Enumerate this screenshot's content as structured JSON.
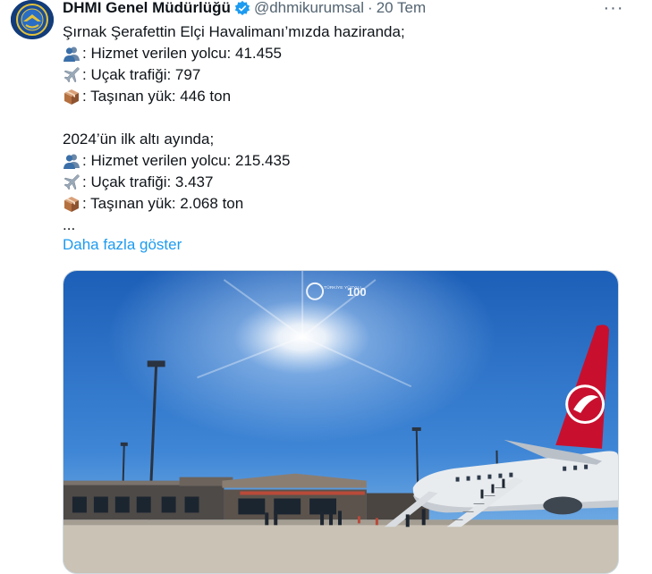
{
  "author": {
    "name": "DHMI Genel Müdürlüğü",
    "handle": "@dhmikurumsal",
    "separator": "·",
    "time": "20 Tem",
    "verified_icon": "verified-badge-icon",
    "avatar_icon": "dhmi-logo-icon"
  },
  "menu": {
    "more_label": "···"
  },
  "tweet": {
    "intro": "Şırnak Şerafettin Elçi Havalimanı’mızda haziranda;",
    "june": [
      {
        "icon": "people-icon",
        "text": ": Hizmet verilen yolcu: 41.455"
      },
      {
        "icon": "airplane-icon",
        "text": ": Uçak trafiği: 797"
      },
      {
        "icon": "package-icon",
        "text": ": Taşınan yük: 446 ton"
      }
    ],
    "h1_heading": "2024’ün ilk altı ayında;",
    "h1": [
      {
        "icon": "people-icon",
        "text": ": Hizmet verilen yolcu: 215.435"
      },
      {
        "icon": "airplane-icon",
        "text": ": Uçak trafiği: 3.437"
      },
      {
        "icon": "package-icon",
        "text": ": Taşınan yük: 2.068 ton"
      }
    ],
    "ellipsis": "...",
    "show_more": "Daha fazla göster"
  },
  "media": {
    "watermark": "TÜRKİYE YÜZYILI",
    "watermark_100": "100",
    "colors": {
      "sky_top": "#1c5fb8",
      "sky_bottom": "#8fc2ec",
      "ground": "#c9c2b5",
      "tail": "#c8102e"
    }
  }
}
